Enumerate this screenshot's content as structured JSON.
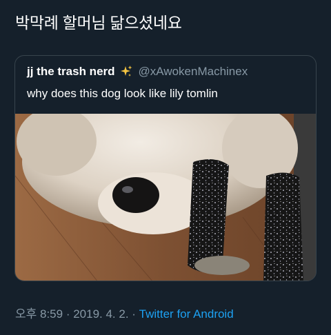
{
  "tweet": {
    "text": "박막례 할머님 닮으셨네요"
  },
  "quoted_tweet": {
    "name": "jj the trash nerd",
    "handle": "@xAwokenMachinex",
    "text": "why does this dog look like lily tomlin",
    "media_icon": "dog-photo"
  },
  "meta": {
    "time": "오후 8:59",
    "sep1": " · ",
    "date": "2019. 4. 2.",
    "sep2": " · ",
    "source": "Twitter for Android"
  },
  "colors": {
    "background": "#15202b",
    "text": "#ffffff",
    "secondary": "#8899a6",
    "link": "#1da1f2",
    "border": "#38444d"
  }
}
